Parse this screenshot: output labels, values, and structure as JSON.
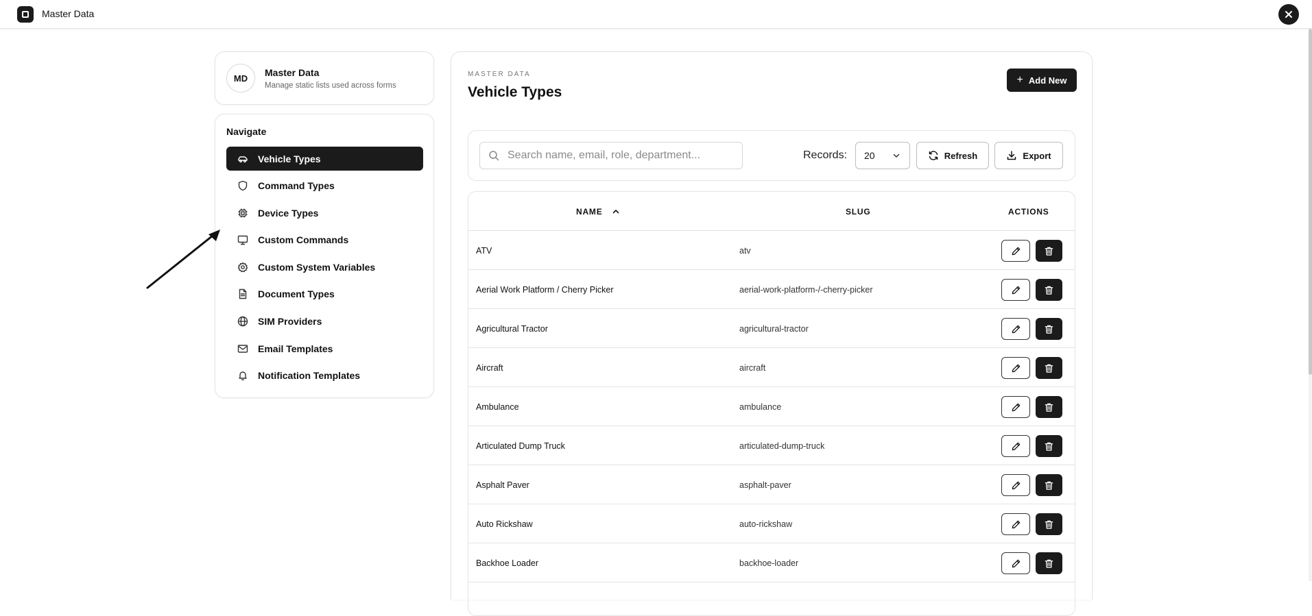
{
  "app": {
    "title": "Master Data"
  },
  "profile": {
    "initials": "MD",
    "name": "Master Data",
    "description": "Manage static lists used across forms"
  },
  "nav": {
    "heading": "Navigate",
    "items": [
      {
        "label": "Vehicle Types",
        "icon": "car-icon",
        "active": true
      },
      {
        "label": "Command Types",
        "icon": "shield-icon"
      },
      {
        "label": "Device Types",
        "icon": "chip-icon"
      },
      {
        "label": "Custom Commands",
        "icon": "monitor-icon"
      },
      {
        "label": "Custom System Variables",
        "icon": "gear-icon"
      },
      {
        "label": "Document Types",
        "icon": "document-icon"
      },
      {
        "label": "SIM Providers",
        "icon": "globe-icon"
      },
      {
        "label": "Email Templates",
        "icon": "mail-icon"
      },
      {
        "label": "Notification Templates",
        "icon": "bell-icon"
      }
    ]
  },
  "header": {
    "eyebrow": "MASTER DATA",
    "title": "Vehicle Types",
    "add_label": "Add New"
  },
  "toolbar": {
    "search_placeholder": "Search name, email, role, department...",
    "records_label": "Records:",
    "records_value": "20",
    "refresh_label": "Refresh",
    "export_label": "Export"
  },
  "table": {
    "columns": {
      "name": "NAME",
      "slug": "SLUG",
      "actions": "ACTIONS"
    },
    "sort": {
      "column": "name",
      "direction": "asc"
    },
    "rows": [
      {
        "name": "ATV",
        "slug": "atv"
      },
      {
        "name": "Aerial Work Platform / Cherry Picker",
        "slug": "aerial-work-platform-/-cherry-picker"
      },
      {
        "name": "Agricultural Tractor",
        "slug": "agricultural-tractor"
      },
      {
        "name": "Aircraft",
        "slug": "aircraft"
      },
      {
        "name": "Ambulance",
        "slug": "ambulance"
      },
      {
        "name": "Articulated Dump Truck",
        "slug": "articulated-dump-truck"
      },
      {
        "name": "Asphalt Paver",
        "slug": "asphalt-paver"
      },
      {
        "name": "Auto Rickshaw",
        "slug": "auto-rickshaw"
      },
      {
        "name": "Backhoe Loader",
        "slug": "backhoe-loader"
      }
    ]
  },
  "colors": {
    "primary": "#1b1b1b",
    "border": "#e4e4e4",
    "muted": "#666666"
  }
}
